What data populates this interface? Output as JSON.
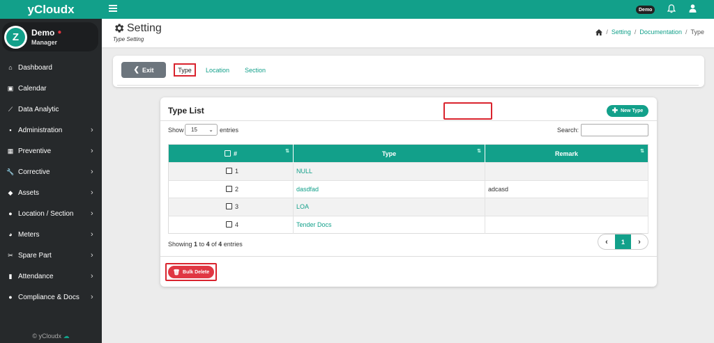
{
  "sidebar": {
    "brand": "yCloudx",
    "user": {
      "name": "Demo",
      "role": "Manager",
      "avatar_initial": "Z"
    },
    "items": [
      {
        "label": "Dashboard",
        "icon": "home-icon",
        "has_children": false
      },
      {
        "label": "Calendar",
        "icon": "calendar-icon",
        "has_children": false
      },
      {
        "label": "Data Analytic",
        "icon": "line-chart-icon",
        "has_children": false
      },
      {
        "label": "Administration",
        "icon": "id-card-icon",
        "has_children": true
      },
      {
        "label": "Preventive",
        "icon": "calendar-grid-icon",
        "has_children": true
      },
      {
        "label": "Corrective",
        "icon": "wrench-icon",
        "has_children": true
      },
      {
        "label": "Assets",
        "icon": "tag-icon",
        "has_children": true
      },
      {
        "label": "Location / Section",
        "icon": "globe-icon",
        "has_children": true
      },
      {
        "label": "Meters",
        "icon": "gauge-icon",
        "has_children": true
      },
      {
        "label": "Spare Part",
        "icon": "tools-icon",
        "has_children": true
      },
      {
        "label": "Attendance",
        "icon": "book-icon",
        "has_children": true
      },
      {
        "label": "Compliance & Docs",
        "icon": "circle-icon",
        "has_children": true
      }
    ],
    "footer": "© yCloudx"
  },
  "topbar": {
    "badge": "Demo"
  },
  "page": {
    "title": "Setting",
    "subtitle": "Type Setting",
    "breadcrumb": [
      "Setting",
      "Documentation",
      "Type"
    ]
  },
  "tabs": {
    "exit_label": "Exit",
    "items": [
      "Type",
      "Location",
      "Section"
    ],
    "active": "Type"
  },
  "list": {
    "title": "Type List",
    "new_button": "New Type",
    "show_label": "Show",
    "length_value": "15",
    "entries_label": "entries",
    "search_label": "Search:",
    "search_value": "",
    "columns": [
      "#",
      "Type",
      "Remark"
    ],
    "rows": [
      {
        "no": "1",
        "type": "NULL",
        "remark": ""
      },
      {
        "no": "2",
        "type": "dasdfad",
        "remark": "adcasd"
      },
      {
        "no": "3",
        "type": "LOA",
        "remark": ""
      },
      {
        "no": "4",
        "type": "Tender Docs",
        "remark": ""
      }
    ],
    "showing": {
      "prefix": "Showing",
      "from": "1",
      "to_word": "to",
      "to": "4",
      "of_word": "of",
      "total": "4",
      "suffix": "entries"
    },
    "current_page": "1",
    "bulk_delete": "Bulk Delete"
  },
  "colors": {
    "accent": "#12a08a",
    "danger": "#e03743",
    "sidebar": "#26292b",
    "highlight_outline": "#d9232d"
  }
}
